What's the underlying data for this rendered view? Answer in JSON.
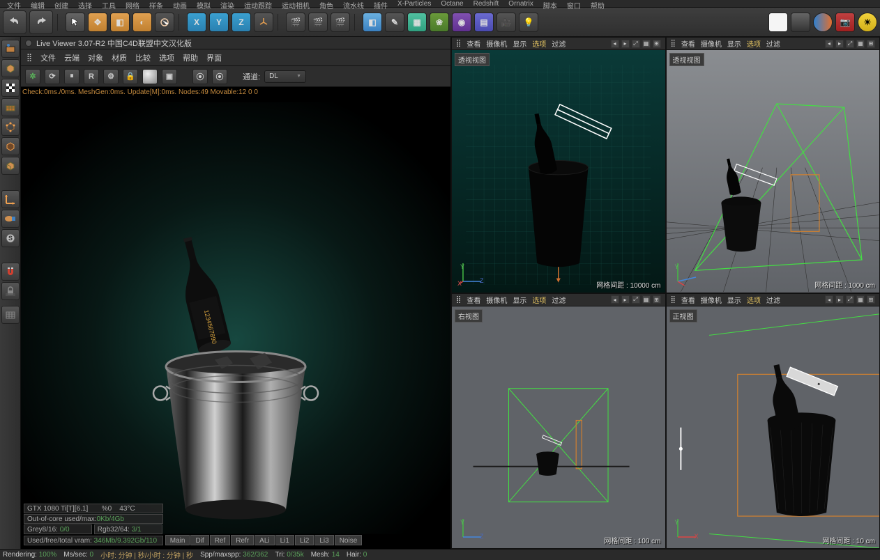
{
  "top_menu": [
    "文件",
    "编辑",
    "创建",
    "选择",
    "工具",
    "网络",
    "样条",
    "动画",
    "模拟",
    "渲染",
    "运动跟踪",
    "运动相机",
    "角色",
    "流水线",
    "插件",
    "X-Particles",
    "Octane",
    "Redshift",
    "Ornatrix",
    "脚本",
    "窗口",
    "帮助"
  ],
  "live_viewer": {
    "title": "Live Viewer 3.07-R2 中国C4D联盟中文汉化版",
    "menu": [
      "文件",
      "云端",
      "对象",
      "材质",
      "比较",
      "选项",
      "帮助",
      "界面"
    ],
    "channel_label": "通道:",
    "channel_value": "DL",
    "status_line": "Check:0ms./0ms. MeshGen:0ms. Update[M]:0ms. Nodes:49 Movable:12  0 0",
    "stats": {
      "gpu": "GTX 1080 Ti[T][6.1]",
      "pct": "%0",
      "temp": "43°C",
      "ooc": "Out-of-core used/max:",
      "ooc_val": "0Kb/4Gb",
      "grey": "Grey8/16: ",
      "grey_val": "0/0",
      "rgb": "Rgb32/64: ",
      "rgb_val": "3/1",
      "vram": "Used/free/total vram: ",
      "vram_val": "346Mb/9.392Gb/110",
      "tabs": [
        "Main",
        "Dif",
        "Ref",
        "Refr",
        "ALi",
        "Li1",
        "Li2",
        "Li3",
        "Noise"
      ]
    }
  },
  "viewport_menu": [
    "查看",
    "摄像机",
    "显示",
    "选项",
    "过滤"
  ],
  "vp": {
    "tl_label": "透视视图",
    "tl_grid": "网格间距 : 10000 cm",
    "tr_label": "透视视图",
    "tr_grid": "网格间距 : 1000 cm",
    "bl_label": "右视图",
    "bl_grid": "网格间距 : 100 cm",
    "br_label": "正视图",
    "br_grid": "网格间距 : 10 cm"
  },
  "status": {
    "rendering": "Rendering: ",
    "rendering_pct": "100%",
    "mssec": "Ms/sec: ",
    "mssec_v": "0",
    "time": "小时: 分钟 | 秒/小时 : 分钟 | 秒",
    "spp": "Spp/maxspp: ",
    "spp_v": "362/362",
    "tri": "Tri: ",
    "tri_v": "0/35k",
    "mesh": "Mesh: ",
    "mesh_v": "14",
    "hair": "Hair: ",
    "hair_v": "0"
  },
  "axis": {
    "x": "X",
    "y": "Y",
    "z": "Z"
  }
}
